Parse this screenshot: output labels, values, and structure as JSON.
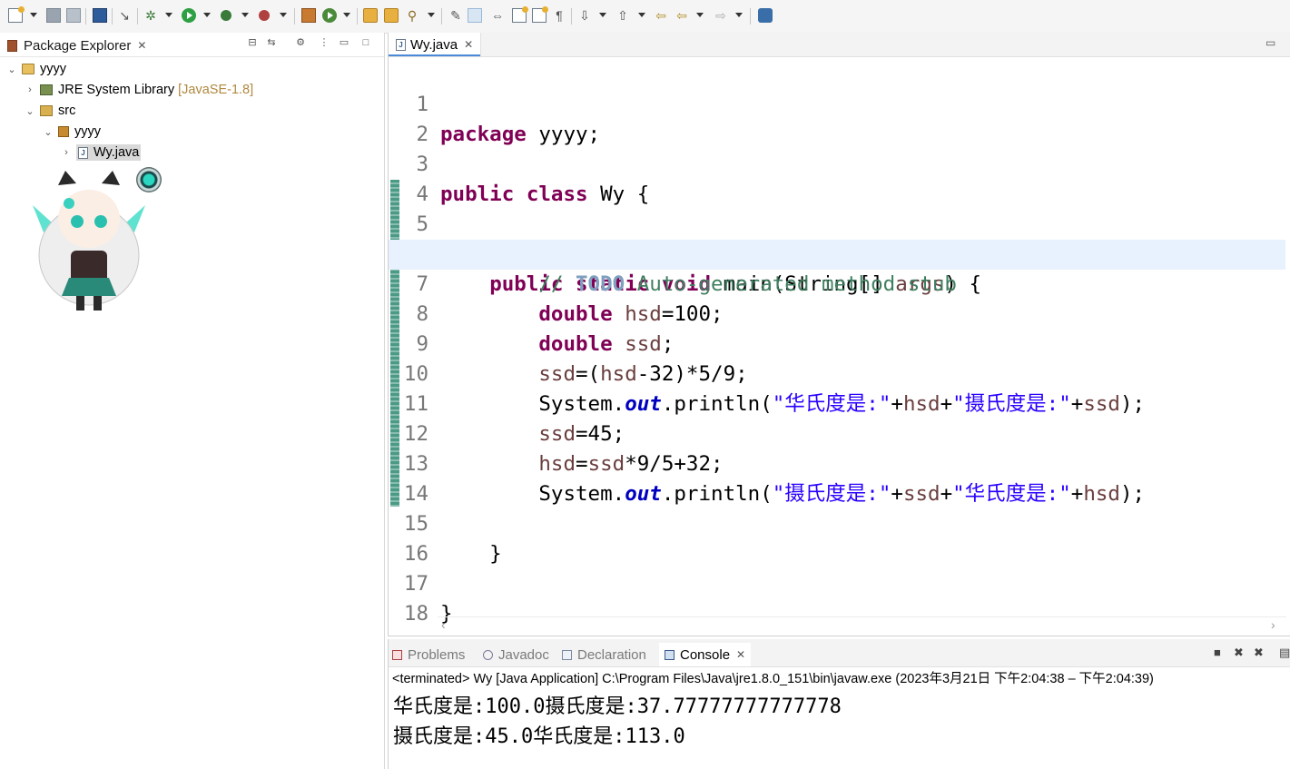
{
  "toolbar": {
    "icons": [
      "new-wizard",
      "save",
      "save-all",
      "open-terminal",
      "skip-breakpoints",
      "debug",
      "run",
      "coverage",
      "external-tools",
      "new-java-package",
      "new-java-class",
      "open-type",
      "open-task",
      "search",
      "toggle-mark-occurrences",
      "toggle-highlight",
      "toggle-block-selection",
      "show-whitespace",
      "next-annotation",
      "previous-annotation",
      "last-edit-location",
      "back",
      "forward",
      "pin-editor"
    ]
  },
  "package_explorer": {
    "title": "Package Explorer",
    "tree": [
      {
        "label": "yyyy",
        "decoration": ""
      },
      {
        "label": "JRE System Library",
        "decoration": "[JavaSE-1.8]"
      },
      {
        "label": "src",
        "decoration": ""
      },
      {
        "label": "yyyy",
        "decoration": ""
      },
      {
        "label": "Wy.java",
        "decoration": ""
      }
    ]
  },
  "editor": {
    "tab_title": "Wy.java",
    "line_numbers": [
      "1",
      "2",
      "3",
      "4",
      "5",
      "6",
      "7",
      "8",
      "9",
      "10",
      "11",
      "12",
      "13",
      "14",
      "15",
      "16",
      "17",
      "18"
    ],
    "code": {
      "l1": {
        "kw": "package",
        "rest": " yyyy;"
      },
      "l3": {
        "kw1": "public",
        "kw2": "class",
        "rest": " Wy {"
      },
      "l5": {
        "indent": "    ",
        "kw1": "public",
        "kw2": "static",
        "kw3": "void",
        "mid": " main(String[] ",
        "var": "args",
        "end": ") {"
      },
      "l6": {
        "indent": "        ",
        "c1": "// ",
        "todo": "TODO",
        "c2": " Auto-generated method stub"
      },
      "l7": {
        "indent": "        ",
        "kw": "double",
        "var": "hsd",
        "rest": "=100;"
      },
      "l8": {
        "indent": "        ",
        "kw": "double",
        "var": "ssd",
        "rest": ";"
      },
      "l9": {
        "indent": "        ",
        "v1": "ssd",
        "a": "=(",
        "v2": "hsd",
        "b": "-32)*5/9;"
      },
      "l10": {
        "indent": "        ",
        "a": "System.",
        "fld": "out",
        "b": ".println(",
        "s1": "\"华氏度是:\"",
        "c": "+",
        "v1": "hsd",
        "d": "+",
        "s2": "\"摄氏度是:\"",
        "e": "+",
        "v2": "ssd",
        "f": ");"
      },
      "l11": {
        "indent": "        ",
        "v1": "ssd",
        "rest": "=45;"
      },
      "l12": {
        "indent": "        ",
        "v1": "hsd",
        "a": "=",
        "v2": "ssd",
        "rest": "*9/5+32;"
      },
      "l13": {
        "indent": "        ",
        "a": "System.",
        "fld": "out",
        "b": ".println(",
        "s1": "\"摄氏度是:\"",
        "c": "+",
        "v1": "ssd",
        "d": "+",
        "s2": "\"华氏度是:\"",
        "e": "+",
        "v2": "hsd",
        "f": ");"
      },
      "l15": {
        "text": "    }"
      },
      "l17": {
        "text": "}"
      }
    }
  },
  "console": {
    "tabs": [
      "Problems",
      "Javadoc",
      "Declaration",
      "Console"
    ],
    "active_tab": "Console",
    "status": "<terminated> Wy [Java Application] C:\\Program Files\\Java\\jre1.8.0_151\\bin\\javaw.exe  (2023年3月21日 下午2:04:38 – 下午2:04:39)",
    "output": [
      "华氏度是:100.0摄氏度是:37.77777777777778",
      "摄氏度是:45.0华氏度是:113.0"
    ]
  },
  "colors": {
    "keyword": "#7f0055",
    "comment": "#3f7f5f",
    "string": "#2a00ff",
    "field": "#0000c0",
    "local_var": "#6a3e3e",
    "current_line": "#e8f2fe",
    "ruler": "#4a9a86"
  }
}
